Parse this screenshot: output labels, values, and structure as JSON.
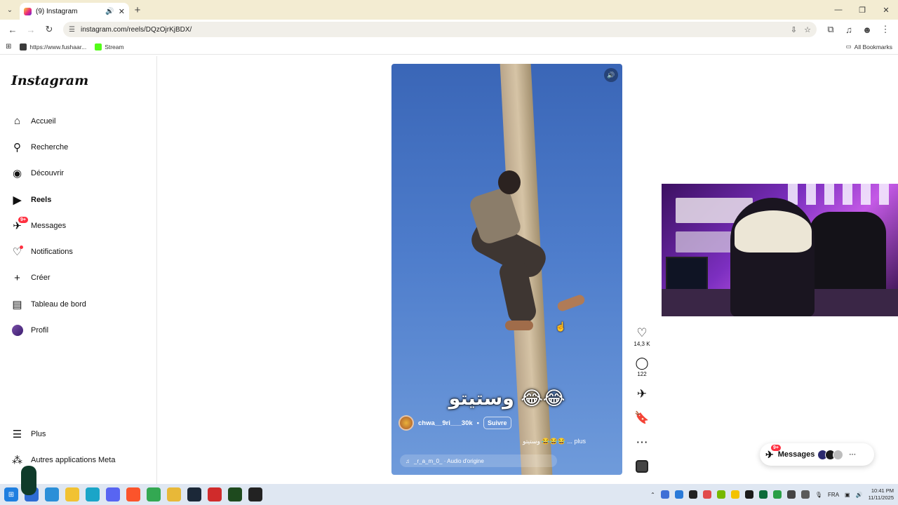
{
  "browser": {
    "tab_title": "(9) Instagram",
    "url": "instagram.com/reels/DQzOjrKjBDX/",
    "bookmarks": [
      {
        "label": "https://www.fushaar...",
        "color": "#3b3b3b"
      },
      {
        "label": "Stream",
        "color": "#53fc18"
      }
    ],
    "all_bookmarks_label": "All Bookmarks"
  },
  "sidebar": {
    "logo": "Instagram",
    "items": [
      {
        "label": "Accueil",
        "icon": "home-icon",
        "glyph": "⌂"
      },
      {
        "label": "Recherche",
        "icon": "search-icon",
        "glyph": "⚲"
      },
      {
        "label": "Découvrir",
        "icon": "compass-icon",
        "glyph": "◉"
      },
      {
        "label": "Reels",
        "icon": "reels-icon",
        "glyph": "▶"
      },
      {
        "label": "Messages",
        "icon": "messenger-icon",
        "glyph": "✈",
        "badge": "9+"
      },
      {
        "label": "Notifications",
        "icon": "heart-icon",
        "glyph": "♡"
      },
      {
        "label": "Créer",
        "icon": "plus-icon",
        "glyph": "+"
      },
      {
        "label": "Tableau de bord",
        "icon": "dashboard-icon",
        "glyph": "▤"
      },
      {
        "label": "Profil",
        "icon": "profile-avatar",
        "glyph": ""
      }
    ],
    "more_label": "Plus",
    "meta_label": "Autres applications Meta"
  },
  "reel": {
    "caption_overlay": "وستيتو 😂😂",
    "author": "chwa__9ri___30k",
    "separator": "•",
    "follow_label": "Suivre",
    "description": "وستيتو 😂😂😂 ... plus",
    "audio": "_r_a_m_0_ · Audio d'origine",
    "likes": "14,3 K",
    "comments": "122"
  },
  "messages_pill": {
    "label": "Messages",
    "badge": "9+"
  },
  "taskbar": {
    "language": "FRA",
    "time": "10:41 PM",
    "date": "11/11/2025"
  },
  "colors": {
    "accent_badge": "#ff3040",
    "reel_sky": "#4d7ccb",
    "chrome_tabbar": "#f3ecd2"
  }
}
